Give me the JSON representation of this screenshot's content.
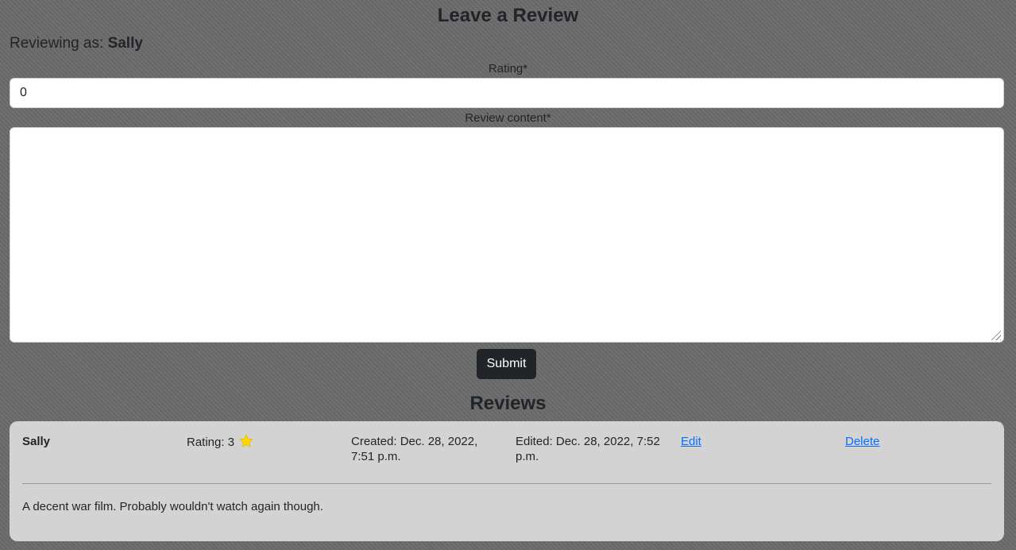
{
  "form": {
    "title": "Leave a Review",
    "reviewing_as_prefix": "Reviewing as: ",
    "reviewing_as_user": "Sally",
    "rating_label": "Rating*",
    "rating_value": "0",
    "content_label": "Review content*",
    "content_value": "",
    "submit_label": "Submit"
  },
  "reviews": {
    "heading": "Reviews",
    "items": [
      {
        "user": "Sally",
        "rating_prefix": "Rating: ",
        "rating": "3",
        "rating_icon": "star-icon",
        "created": "Created: Dec. 28, 2022, 7:51 p.m.",
        "edited": "Edited: Dec. 28, 2022, 7:52 p.m.",
        "edit_label": "Edit",
        "delete_label": "Delete",
        "content": "A decent war film. Probably wouldn't watch again though."
      }
    ]
  },
  "colors": {
    "background": "#6b6b6b",
    "card": "#d3d3d3",
    "button": "#212529",
    "link": "#0d6efd",
    "star": "#ffd700"
  }
}
